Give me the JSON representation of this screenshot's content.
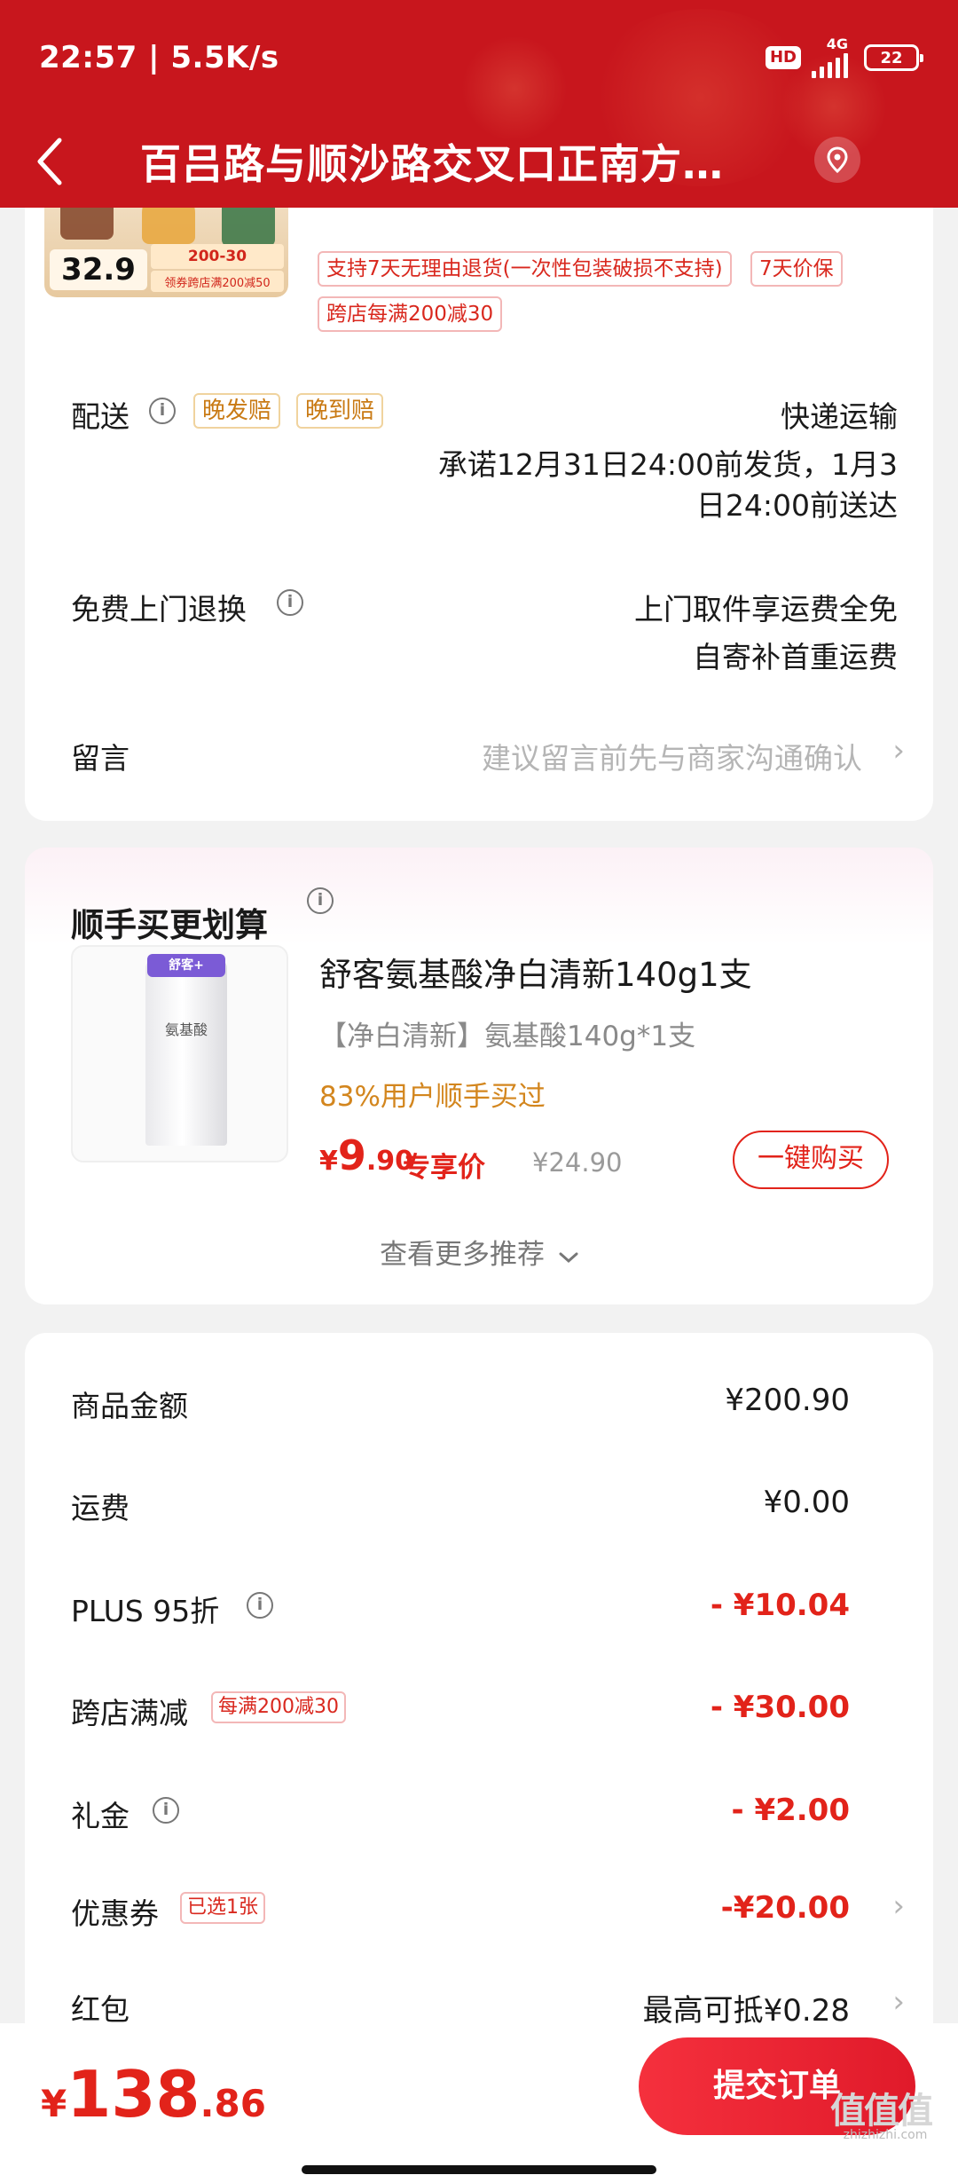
{
  "status_bar": {
    "time_speed": "22:57 | 5.5K/s",
    "hd": "HD",
    "network": "4G",
    "battery": "22"
  },
  "header": {
    "title": "百吕路与顺沙路交叉口正南方…"
  },
  "product_top": {
    "thumb_price": "32.9",
    "thumb_promo": "200-30",
    "thumb_promo2": "领券跨店满200减50",
    "service_tag": "支持7天无理由退货(一次性包装破损不支持)",
    "price_protect_tag": "7天价保",
    "cross_store_tag": "跨店每满200减30"
  },
  "delivery": {
    "label": "配送",
    "tag_late_ship": "晚发赔",
    "tag_late_arrive": "晚到赔",
    "method": "快递运输",
    "promise_line1": "承诺12月31日24:00前发货，1月3",
    "promise_line2": "日24:00前送达"
  },
  "free_return": {
    "label": "免费上门退换",
    "line1": "上门取件享运费全免",
    "line2": "自寄补首重运费"
  },
  "message": {
    "label": "留言",
    "placeholder": "建议留言前先与商家沟通确认"
  },
  "recommend": {
    "title": "顺手买更划算",
    "product_name": "舒客氨基酸净白清新140g1支",
    "spec": "【净白清新】氨基酸140g*1支",
    "social": "83%用户顺手买过",
    "price_currency": "¥",
    "price_int": "9",
    "price_dec": ".90",
    "exclusive_label": "专享价",
    "original_price": "¥24.90",
    "buy_button": "一键购买",
    "more": "查看更多推荐",
    "img_brand": "舒客+",
    "img_text": "氨基酸"
  },
  "price_breakdown": {
    "goods_label": "商品金额",
    "goods_value": "¥200.90",
    "shipping_label": "运费",
    "shipping_value": "¥0.00",
    "plus_label": "PLUS 95折",
    "plus_value": "- ¥10.04",
    "cross_store_label": "跨店满减",
    "cross_store_tag": "每满200减30",
    "cross_store_value": "- ¥30.00",
    "gift_label": "礼金",
    "gift_value": "- ¥2.00",
    "coupon_label": "优惠券",
    "coupon_tag": "已选1张",
    "coupon_value": "-¥20.00",
    "redpacket_label": "红包",
    "redpacket_value": "最高可抵¥0.28"
  },
  "bottom": {
    "total_currency": "¥",
    "total_int": "138",
    "total_dec": ".86",
    "submit_button": "提交订单"
  },
  "watermark": {
    "text": "zhizhizhi.com",
    "glyph": "值值值"
  },
  "colors": {
    "header_red": "#c8161d",
    "price_red": "#e2231a",
    "gold": "#c97a14"
  }
}
